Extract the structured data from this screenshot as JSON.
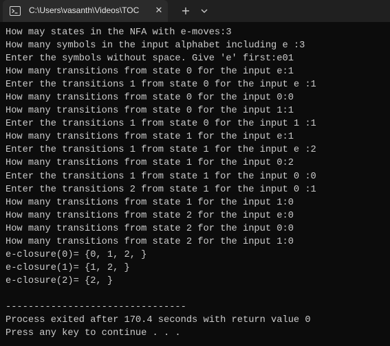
{
  "tab": {
    "title": "C:\\Users\\vasanth\\Videos\\TOC",
    "close_glyph": "✕",
    "new_tab_glyph": "+"
  },
  "console": {
    "lines": [
      "How may states in the NFA with e-moves:3",
      "How many symbols in the input alphabet including e :3",
      "Enter the symbols without space. Give 'e' first:e01",
      "How many transitions from state 0 for the input e:1",
      "Enter the transitions 1 from state 0 for the input e :1",
      "How many transitions from state 0 for the input 0:0",
      "How many transitions from state 0 for the input 1:1",
      "Enter the transitions 1 from state 0 for the input 1 :1",
      "How many transitions from state 1 for the input e:1",
      "Enter the transitions 1 from state 1 for the input e :2",
      "How many transitions from state 1 for the input 0:2",
      "Enter the transitions 1 from state 1 for the input 0 :0",
      "Enter the transitions 2 from state 1 for the input 0 :1",
      "How many transitions from state 1 for the input 1:0",
      "How many transitions from state 2 for the input e:0",
      "How many transitions from state 2 for the input 0:0",
      "How many transitions from state 2 for the input 1:0",
      "e-closure(0)= {0, 1, 2, }",
      "e-closure(1)= {1, 2, }",
      "e-closure(2)= {2, }",
      "",
      "--------------------------------",
      "Process exited after 170.4 seconds with return value 0",
      "Press any key to continue . . ."
    ]
  }
}
